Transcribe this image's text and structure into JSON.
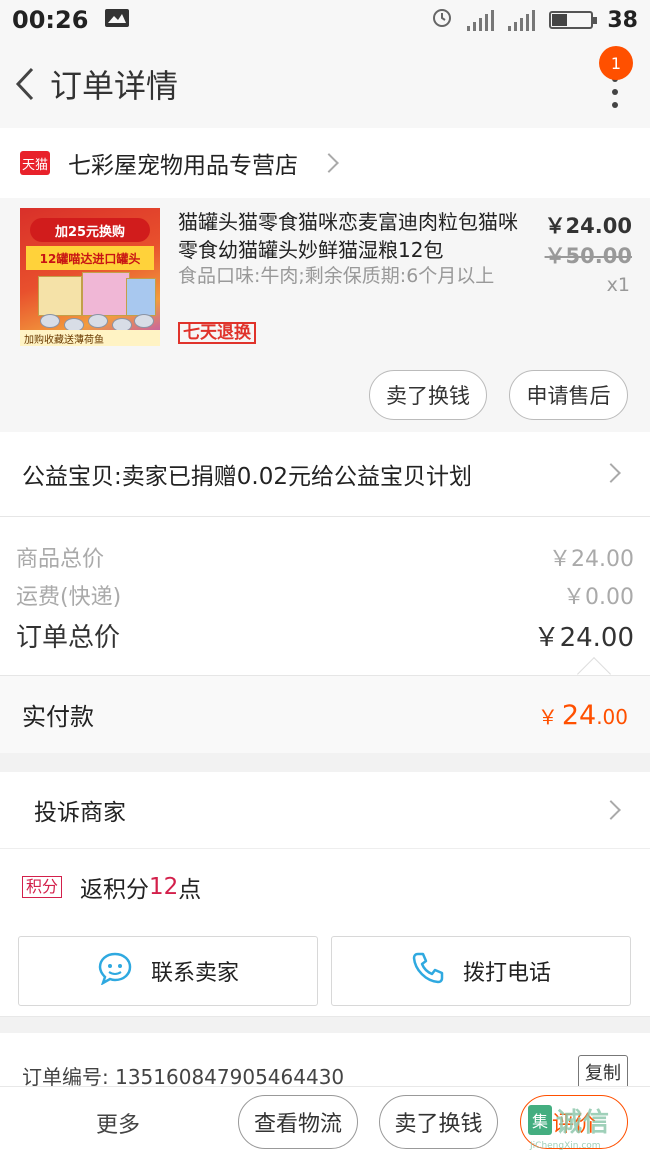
{
  "status_bar": {
    "time": "00:26",
    "battery": "38",
    "battery_fraction": 0.38
  },
  "nav": {
    "title": "订单详情",
    "badge_count": "1"
  },
  "shop": {
    "platform_icon_label": "天猫",
    "name": "七彩屋宠物用品专营店"
  },
  "item": {
    "title": "猫罐头猫零食猫咪恋麦富迪肉粒包猫咪零食幼猫罐头妙鲜猫湿粮12包",
    "sku": "食品口味:牛肉;剩余保质期:6个月以上",
    "service_tag": "七天退换",
    "price_now": "￥24.00",
    "price_old": "￥50.00",
    "quantity": "x1",
    "image_text_top": "加25元换购",
    "image_text_mid": "12罐喵达进口罐头",
    "image_text_bottom": "加购收藏送薄荷鱼",
    "btn_sell": "卖了换钱",
    "btn_after_sale": "申请售后"
  },
  "charity": {
    "text": "公益宝贝:卖家已捐赠0.02元给公益宝贝计划"
  },
  "summary": {
    "goods_label": "商品总价",
    "goods_value": "￥24.00",
    "shipping_label": "运费(快递)",
    "shipping_value": "￥0.00",
    "total_label": "订单总价",
    "total_value": "￥24.00"
  },
  "paid": {
    "label": "实付款",
    "symbol": "￥",
    "integer": "24",
    "decimal": ".00"
  },
  "complain": {
    "text": "投诉商家"
  },
  "points": {
    "tag": "积分",
    "text_prefix": "返积分",
    "value": "12",
    "text_suffix": "点"
  },
  "contact": {
    "seller_label": "联系卖家",
    "call_label": "拨打电话"
  },
  "order": {
    "number_text": "订单编号: 135160847905464430",
    "copy_label": "复制"
  },
  "bottom_bar": {
    "more_label": "更多",
    "logistics_label": "查看物流",
    "sell_label": "卖了换钱",
    "review_label": "评价"
  },
  "watermark": {
    "logo": "集",
    "text": "诚信",
    "sub": "JiChengXin.com"
  },
  "colors": {
    "accent": "#ff5000",
    "tmall_red": "#e8222b",
    "points_red": "#d3204b",
    "contact_blue": "#2fa9e0"
  }
}
